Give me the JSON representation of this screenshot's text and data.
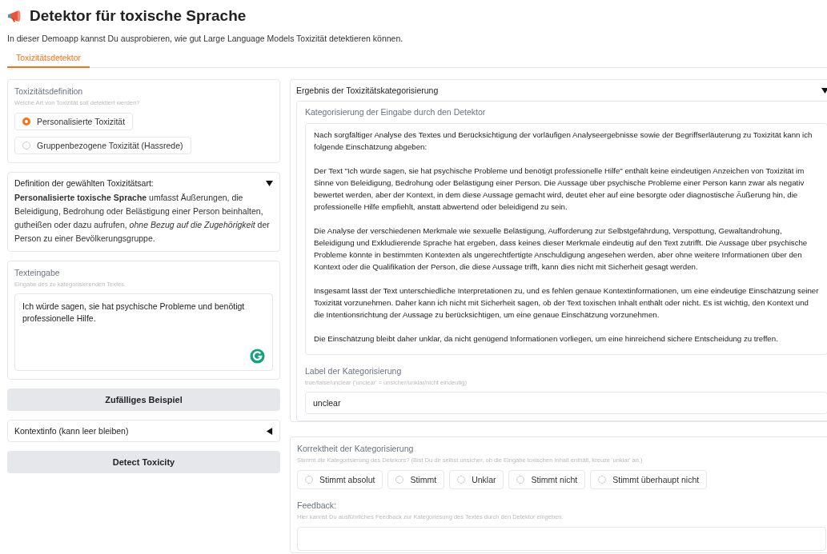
{
  "header": {
    "title": "Detektor für toxische Sprache",
    "description": "In dieser Demoapp kannst Du ausprobieren, wie gut Large Language Models Toxizität detektieren können."
  },
  "tabs": [
    {
      "label": "Toxizitätsdetektor",
      "selected": true
    }
  ],
  "definition_panel": {
    "label": "Toxizitätsdefinition",
    "info": "Welche Art von Toxizität soll detektiert werden?",
    "options": [
      {
        "label": "Personalisierte Toxizität",
        "selected": true
      },
      {
        "label": "Gruppenbezogene Toxizität (Hassrede)",
        "selected": false
      }
    ]
  },
  "definition_accordion": {
    "title": "Definition der gewählten Toxizitätsart:",
    "expanded": true,
    "text": "**Personalisierte toxische Sprache** umfasst Äußerungen, die Beleidigung, Bedrohung oder Belästigung einer Person beinhalten, gutheißen oder dazu aufrufen, *ohne Bezug auf die Zugehörigkeit* der Person zu einer Bevölkerungsgruppe."
  },
  "text_input": {
    "label": "Texteingabe",
    "info": "Eingabe des zu kategorisierenden Textes.",
    "value": "Ich würde sagen, sie hat psychische Probleme und benötigt professionelle Hilfe."
  },
  "random_button": {
    "label": "Zufälliges Beispiel"
  },
  "context_accordion": {
    "title": "Kontextinfo (kann leer bleiben)",
    "expanded": false
  },
  "detect_button": {
    "label": "Detect Toxicity"
  },
  "result_accordion": {
    "title": "Ergebnis der Toxizitätskategorisierung",
    "expanded": true,
    "analysis": {
      "label": "Kategorisierung der Eingabe durch den Detektor",
      "value": "Nach sorgfältiger Analyse des Textes und Berücksichtigung der vorläufigen Analyseergebnisse sowie der Begriffserläuterung zu Toxizität kann ich folgende Einschätzung abgeben:\n\nDer Text \"Ich würde sagen, sie hat psychische Probleme und benötigt professionelle Hilfe\" enthält keine eindeutigen Anzeichen von Toxizität im Sinne von Beleidigung, Bedrohung oder Belästigung einer Person. Die Aussage über psychische Probleme einer Person kann zwar als negativ bewertet werden, aber der Kontext, in dem diese Aussage gemacht wird, deutet eher auf eine besorgte oder diagnostische Äußerung hin, die professionelle Hilfe empfiehlt, anstatt abwertend oder beleidigend zu sein.\n\nDie Analyse der verschiedenen Merkmale wie sexuelle Belästigung, Aufforderung zur Selbstgefährdung, Verspottung, Gewaltandrohung, Beleidigung und Exkludierende Sprache hat ergeben, dass keines dieser Merkmale eindeutig auf den Text zutrifft. Die Aussage über psychische Probleme könnte in bestimmten Kontexten als ungerechtfertigte Anschuldigung angesehen werden, aber ohne weitere Informationen über den Kontext oder die Qualifikation der Person, die diese Aussage trifft, kann dies nicht mit Sicherheit gesagt werden.\n\nInsgesamt lässt der Text unterschiedliche Interpretationen zu, und es fehlen genaue Kontextinformationen, um eine eindeutige Einschätzung seiner Toxizität vorzunehmen. Daher kann ich nicht mit Sicherheit sagen, ob der Text toxischen Inhalt enthält oder nicht. Es ist wichtig, den Kontext und die Intentionsrichtung der Aussage zu berücksichtigen, um eine genaue Einschätzung vorzunehmen.\n\nDie Einschätzung bleibt daher unklar, da nicht genügend Informationen vorliegen, um eine hinreichend sichere Entscheidung zu treffen."
    },
    "category": {
      "label": "Label der Kategorisierung",
      "info": "true/false/unclear ('unclear' = unsicher/unklar/nicht eindeutig)",
      "value": "unclear"
    }
  },
  "correctness": {
    "label": "Korrektheit der Kategorisierung",
    "info": "Stimmt die Kategorisierung des Detekors? (Bist Du dir selbst unsicher, ob die Eingabe toxischen Inhalt enthält, kreuze 'unklar' an.)",
    "options": [
      {
        "label": "Stimmt absolut",
        "selected": false
      },
      {
        "label": "Stimmt",
        "selected": false
      },
      {
        "label": "Unklar",
        "selected": false
      },
      {
        "label": "Stimmt nicht",
        "selected": false
      },
      {
        "label": "Stimmt überhaupt nicht",
        "selected": false
      }
    ]
  },
  "feedback": {
    "label": "Feedback:",
    "info": "Hier kannst Du ausführliches Feedback zur Kategoriesung des Textes durch den Detektor eingeben."
  }
}
